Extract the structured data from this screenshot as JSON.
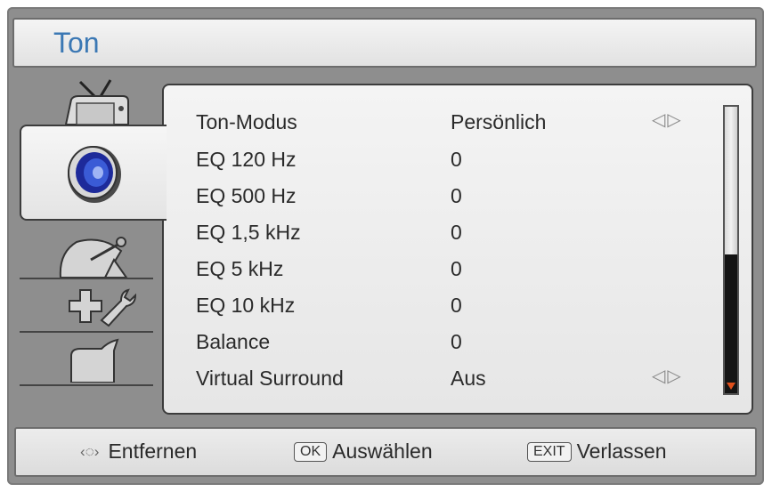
{
  "menu": {
    "title": "Ton"
  },
  "tabs": [
    {
      "id": "picture",
      "icon": "tv-icon"
    },
    {
      "id": "sound",
      "icon": "speaker-icon",
      "active": true
    },
    {
      "id": "channel",
      "icon": "satellite-dish-icon"
    },
    {
      "id": "setup",
      "icon": "tools-icon"
    },
    {
      "id": "lock",
      "icon": "lock-icon"
    }
  ],
  "settings": [
    {
      "label": "Ton-Modus",
      "value": "Persönlich",
      "arrows": "◁▷"
    },
    {
      "label": "EQ 120 Hz",
      "value": "0"
    },
    {
      "label": "EQ 500 Hz",
      "value": "0"
    },
    {
      "label": "EQ 1,5 kHz",
      "value": "0"
    },
    {
      "label": "EQ 5 kHz",
      "value": "0"
    },
    {
      "label": "EQ 10 kHz",
      "value": "0"
    },
    {
      "label": "Balance",
      "value": "0"
    },
    {
      "label": "Virtual Surround",
      "value": "Aus",
      "arrows": "◁▷"
    }
  ],
  "footer": {
    "navigate": {
      "icon": "dpad-icon",
      "label": "Entfernen"
    },
    "ok": {
      "key": "OK",
      "label": "Auswählen"
    },
    "exit": {
      "key": "EXIT",
      "label": "Verlassen"
    }
  },
  "colors": {
    "title": "#3b78b4",
    "scroll_marker": "#e0501c",
    "frame": "#8e8e8e"
  }
}
